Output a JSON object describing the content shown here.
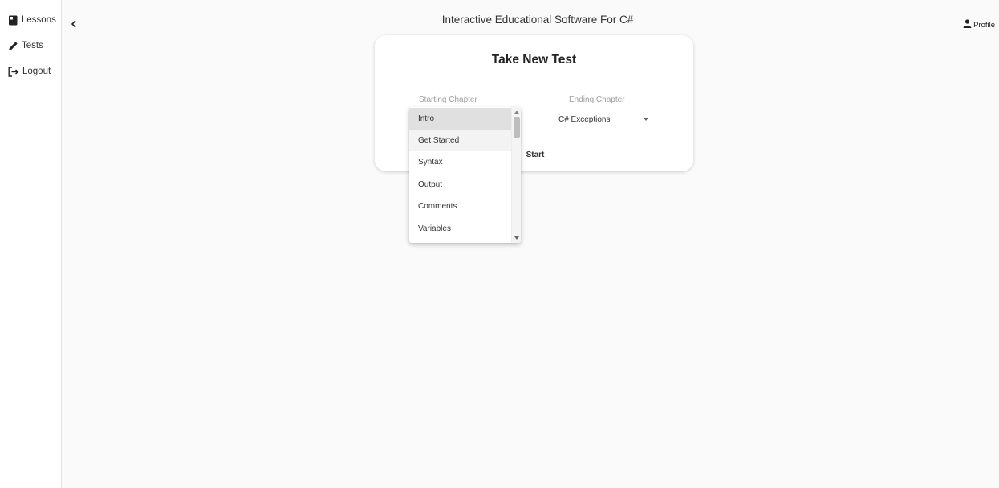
{
  "sidebar": {
    "items": [
      {
        "label": "Lessons",
        "icon": "book-icon"
      },
      {
        "label": "Tests",
        "icon": "pencil-icon"
      },
      {
        "label": "Logout",
        "icon": "logout-icon"
      }
    ]
  },
  "header": {
    "title": "Interactive Educational Software For C#",
    "profile_label": "Profile"
  },
  "card": {
    "title": "Take New Test",
    "starting_label": "Starting Chapter",
    "ending_label": "Ending Chapter",
    "ending_value": "C# Exceptions",
    "start_label": "Start"
  },
  "dropdown": {
    "selected": "Intro",
    "hovered": "Get Started",
    "options": [
      "Intro",
      "Get Started",
      "Syntax",
      "Output",
      "Comments",
      "Variables"
    ]
  },
  "colors": {
    "background": "#fafafa",
    "selected_option": "#e0e0e0",
    "hover_option": "#f3f3f3",
    "label_gray": "#9e9e9e"
  }
}
